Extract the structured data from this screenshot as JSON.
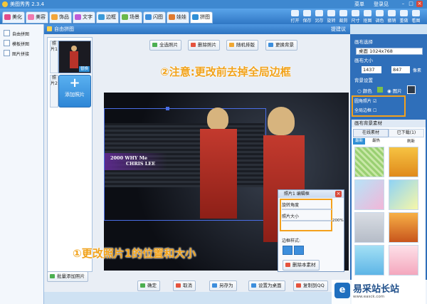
{
  "app": {
    "title": "美图秀秀 2.3.4"
  },
  "window_controls": {
    "menu": "菜单",
    "login": "登录见"
  },
  "tabs": [
    {
      "label": "美化",
      "color": "#e24b8a"
    },
    {
      "label": "美容",
      "color": "#f07ab0"
    },
    {
      "label": "饰品",
      "color": "#f3a63a"
    },
    {
      "label": "文字",
      "color": "#c05bd7"
    },
    {
      "label": "边框",
      "color": "#3a9ad9"
    },
    {
      "label": "场景",
      "color": "#6bb84a"
    },
    {
      "label": "闪图",
      "color": "#3c8edc"
    },
    {
      "label": "娃娃",
      "color": "#e07a2f"
    },
    {
      "label": "拼图",
      "color": "#2f8fd6"
    }
  ],
  "right_tools": [
    "打开",
    "保存",
    "另存",
    "旋转",
    "裁剪",
    "尺寸",
    "抠图",
    "调色",
    "撤销",
    "重做",
    "看图"
  ],
  "left_panel": [
    "自由拼图",
    "模板拼图",
    "图片拼接"
  ],
  "dialog": {
    "title": "自由拼图",
    "help": "提建议"
  },
  "thumbs": {
    "photo1_label": "照片1",
    "replace": "替换",
    "photo2_label": "照片2",
    "add_photo": "添加照片",
    "batch_add": "批量添加照片"
  },
  "top_buttons": [
    "全选照片",
    "删除照片",
    "随机排版",
    "更换背景"
  ],
  "canvas_text": {
    "line1": "2000 WHY Me",
    "line2": "CHRIS LEE"
  },
  "annotations": {
    "note2": "②注意:更改前去掉全局边框",
    "note1": "①更改照片1的位置和大小"
  },
  "popup": {
    "title": "照片1 编辑框",
    "rotate": "旋转角度",
    "size": "照片大小",
    "percent": "200%",
    "border_style": "边框样式:",
    "delete": "删除本素材"
  },
  "right_panel": {
    "canvas_select": "画布选择",
    "canvas_size_value": "桌面  1024x768",
    "canvas_size_label": "画布大小",
    "width": "1437",
    "height": "847",
    "unit": "像素",
    "bg_settings": "背景设置",
    "color_opt": "颜色",
    "image_opt": "图片",
    "round_corner": "圆角照片",
    "global_border": "全局边框",
    "material_header": "画布背景素材",
    "tab_online": "在线素材",
    "tab_downloaded": "已下载(1)",
    "tag_common": "最新",
    "tag_more": "最热",
    "refresh": "刷新"
  },
  "bottom_buttons": [
    "确定",
    "取消",
    "另存为",
    "设置为桌面",
    "复制到QQ"
  ],
  "watermark": {
    "name": "易采站长站",
    "sub": "www.easck.com"
  },
  "colors": {
    "accent": "#2f6fba",
    "note": "#f1a21a",
    "canvas_bg": "#0c0e14",
    "orange_box": "#f4a11c"
  }
}
